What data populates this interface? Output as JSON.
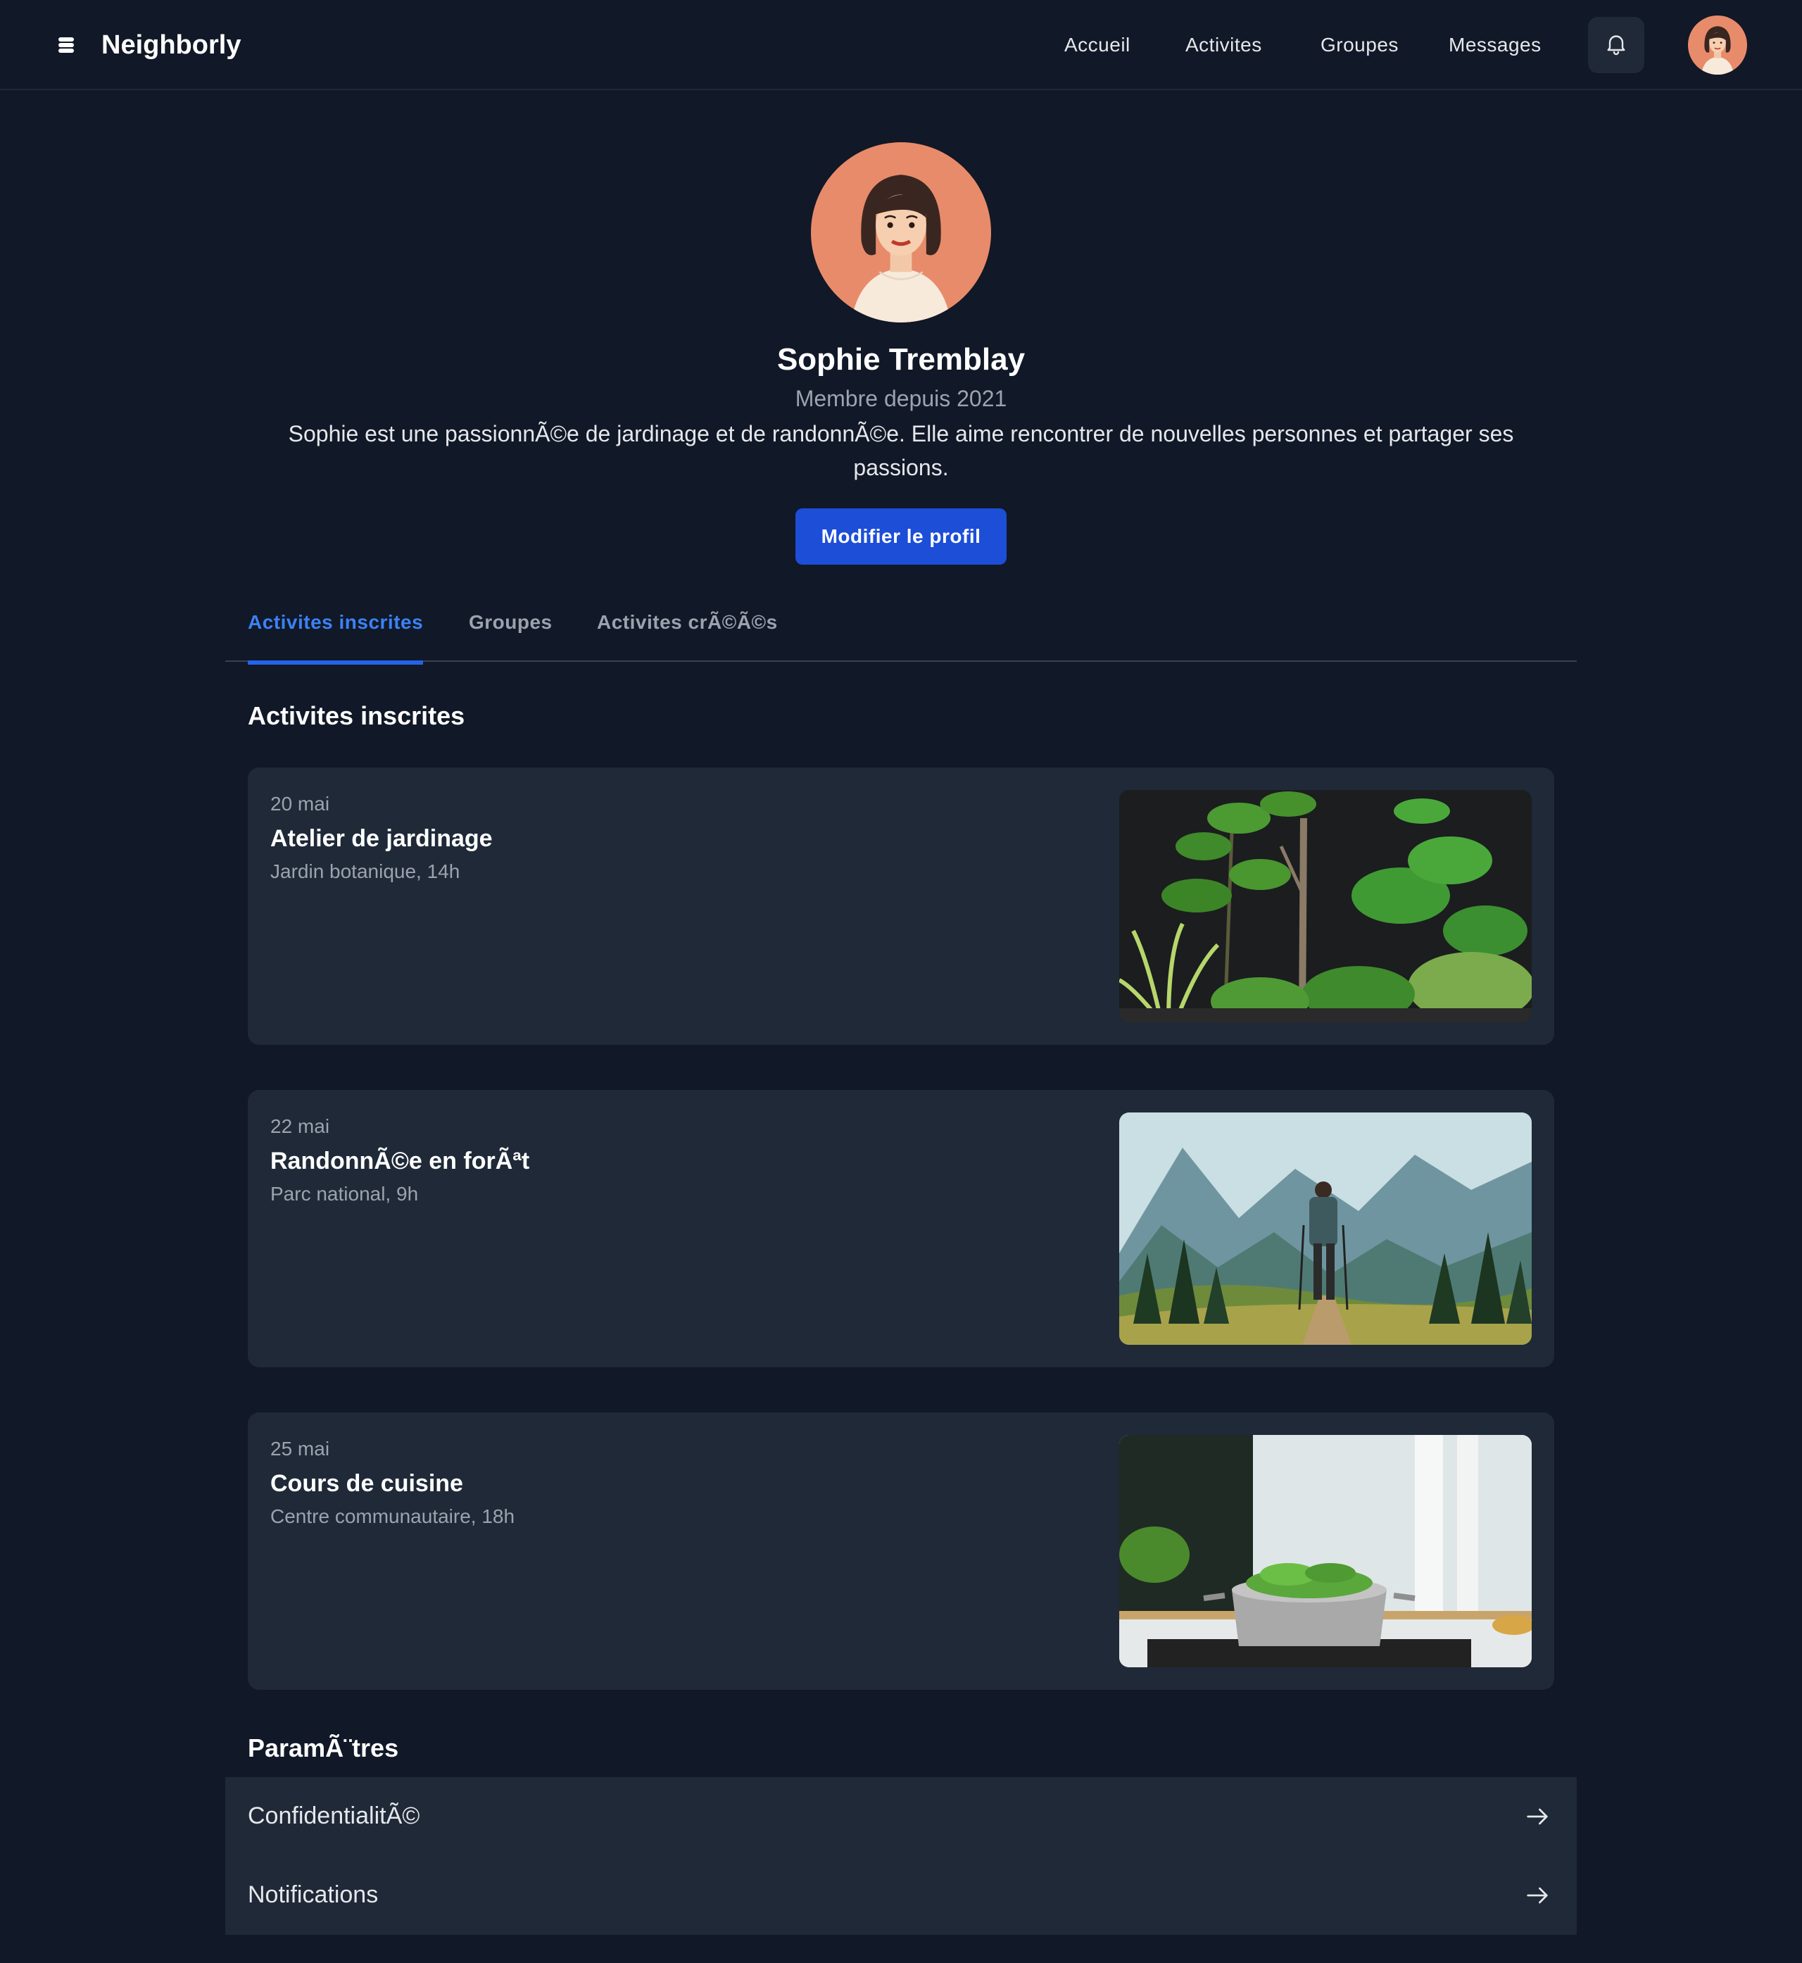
{
  "header": {
    "brand": "Neighborly",
    "nav": [
      "Accueil",
      "Activites",
      "Groupes",
      "Messages"
    ],
    "icons": {
      "logo": "stack-icon",
      "notifications": "bell-icon"
    }
  },
  "profile": {
    "name": "Sophie Tremblay",
    "member_since": "Membre depuis 2021",
    "bio": "Sophie est une passionnÃ©e de jardinage et de randonnÃ©e. Elle aime rencontrer de nouvelles personnes et partager ses passions.",
    "edit_button": "Modifier le profil"
  },
  "tabs": [
    {
      "label": "Activites inscrites",
      "active": true
    },
    {
      "label": "Groupes",
      "active": false
    },
    {
      "label": "Activites crÃ©Ã©s",
      "active": false
    }
  ],
  "activities_section": {
    "title": "Activites inscrites",
    "items": [
      {
        "date": "20 mai",
        "title": "Atelier de jardinage",
        "location": "Jardin botanique, 14h",
        "image": "plants-photo"
      },
      {
        "date": "22 mai",
        "title": "RandonnÃ©e en forÃªt",
        "location": "Parc national, 9h",
        "image": "hiker-mountains-photo"
      },
      {
        "date": "25 mai",
        "title": "Cours de cuisine",
        "location": "Centre communautaire, 18h",
        "image": "cooking-pot-photo"
      }
    ]
  },
  "settings": {
    "title": "ParamÃ¨tres",
    "items": [
      {
        "label": "ConfidentialitÃ©"
      },
      {
        "label": "Notifications"
      }
    ]
  },
  "colors": {
    "background": "#111827",
    "card": "#1f2937",
    "accent": "#1d4ed8",
    "tab_active": "#3b82f6",
    "muted_text": "#9ca3af"
  }
}
